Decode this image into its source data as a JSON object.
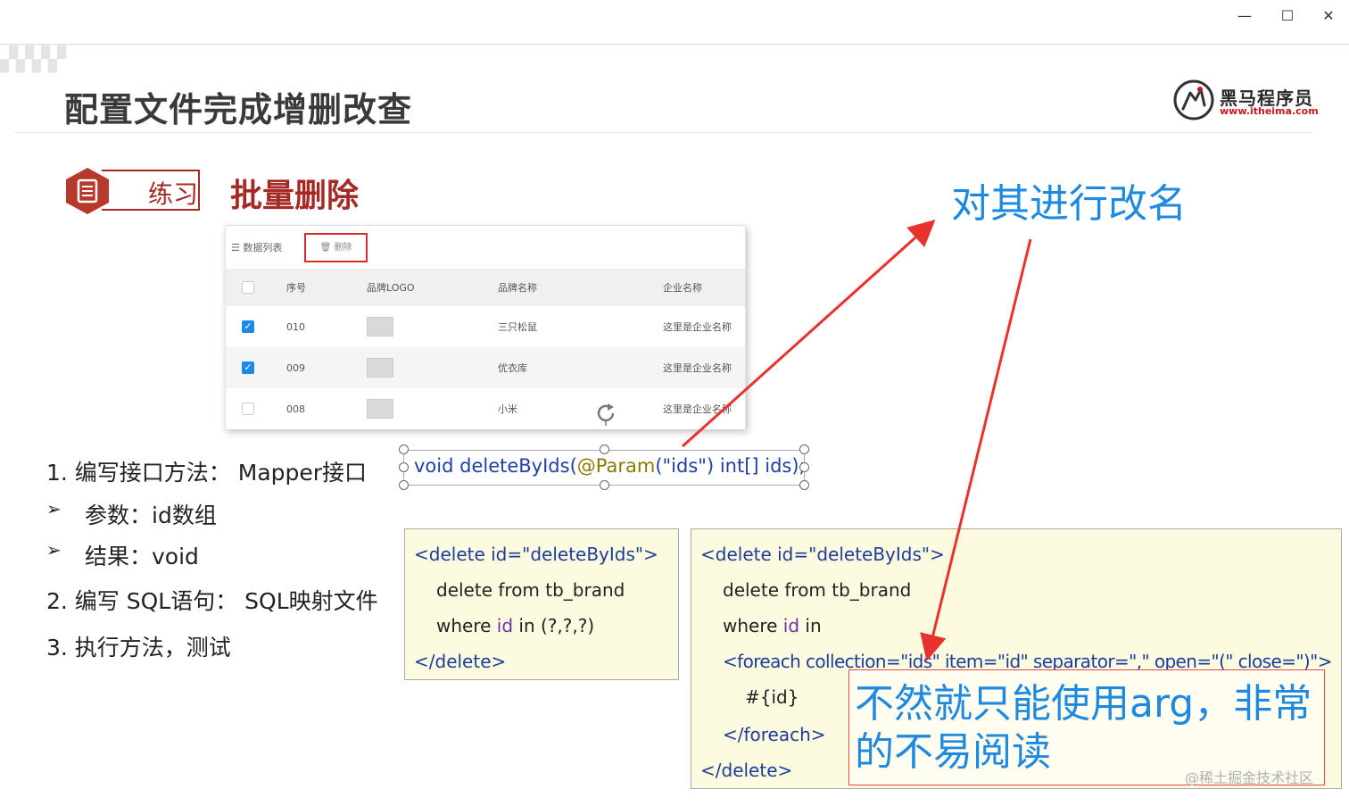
{
  "window": {
    "minimize_glyph": "—",
    "maximize_glyph": "☐",
    "close_glyph": "✕"
  },
  "slide": {
    "title": "配置文件完成增删改查",
    "logo": {
      "name": "黑马程序员",
      "url": "www.itheima.com",
      "brand_color": "#c4161c"
    },
    "exercise_label": "练习",
    "section_title": "批量删除",
    "accent_color": "#a52a24"
  },
  "table_shot": {
    "toolbar": {
      "list_label": "☰ 数据列表",
      "delete_button": "🗑 删除"
    },
    "headers": [
      "序号",
      "品牌LOGO",
      "品牌名称",
      "企业名称"
    ],
    "rows": [
      {
        "checked": true,
        "no": "010",
        "name": "三只松鼠",
        "company": "这里是企业名称"
      },
      {
        "checked": true,
        "no": "009",
        "name": "优衣库",
        "company": "这里是企业名称"
      },
      {
        "checked": false,
        "no": "008",
        "name": "小米",
        "company": "这里是企业名称"
      }
    ]
  },
  "steps": {
    "s1": "1.   编写接口方法：  Mapper接口",
    "p1": "参数：id数组",
    "p2": "结果：void",
    "s2": "2.   编写 SQL语句：  SQL映射文件",
    "s3": "3.   执行方法，测试",
    "bullet": "➢"
  },
  "code_line": {
    "part1": "void deleteByIds(",
    "part2": "@Param",
    "part3": "(\"ids\") int[] ids);"
  },
  "code_box_left": {
    "l1": "<delete id=\"deleteByIds\">",
    "l2": "delete from tb_brand",
    "l3a": "where ",
    "l3b": "id",
    "l3c": " in (?,?,?)",
    "l4": "</delete>"
  },
  "code_box_right": {
    "l1": "<delete id=\"deleteByIds\">",
    "l2": "delete from tb_brand",
    "l3a": "where ",
    "l3b": "id",
    "l3c": " in",
    "l4": "<foreach collection=\"ids\" item=\"id\" separator=\",\" open=\"(\" close=\")\">",
    "l5": "#{id}",
    "l6": "</foreach>",
    "l7": "</delete>"
  },
  "annotation_top": "对其进行改名",
  "annotation_note": "不然就只能使用arg，非常的不易阅读",
  "watermark": "@稀土掘金技术社区",
  "colors": {
    "annotation": "#1d8ae0",
    "arrow": "#e8322c",
    "code_bg": "#fcfadf",
    "check_blue": "#1e88e5"
  }
}
